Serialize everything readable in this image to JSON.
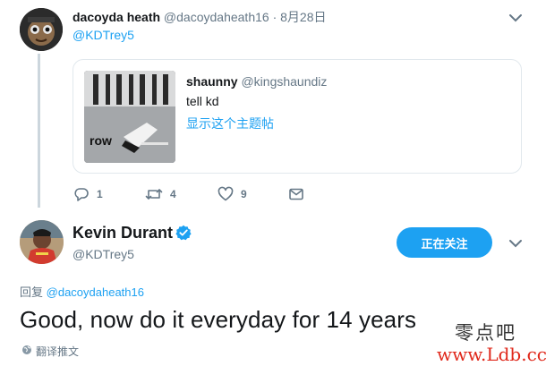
{
  "reply_tweet": {
    "display_name": "dacoyda heath",
    "handle": "@dacoydaheath16",
    "separator": "·",
    "date": "8月28日",
    "reply_to": "@KDTrey5",
    "quoted_tweet": {
      "display_name": "shaunny",
      "handle": "@kingshaundiz",
      "text": "tell kd",
      "show_thread_link": "显示这个主题帖",
      "image_caption": "row"
    },
    "actions": {
      "reply_count": "1",
      "retweet_count": "4",
      "like_count": "9"
    }
  },
  "main_tweet": {
    "display_name": "Kevin Durant",
    "handle": "@KDTrey5",
    "follow_button_label": "正在关注",
    "replying_prefix": "回复",
    "replying_to": "@dacoydaheath16",
    "text": "Good, now do it everyday for 14 years",
    "translate_label": "翻译推文"
  },
  "watermark": {
    "line1": "零点吧",
    "line2": "www.Ldb.cc"
  },
  "colors": {
    "accent": "#1da1f2",
    "muted": "#657786",
    "text": "#14171a",
    "border": "#e1e8ed",
    "thread_line": "#ccd6dd",
    "watermark_red": "#e0281b"
  },
  "icons": [
    "reply-icon",
    "retweet-icon",
    "like-icon",
    "direct-message-icon",
    "verified-icon",
    "chevron-down-icon",
    "globe-icon"
  ]
}
